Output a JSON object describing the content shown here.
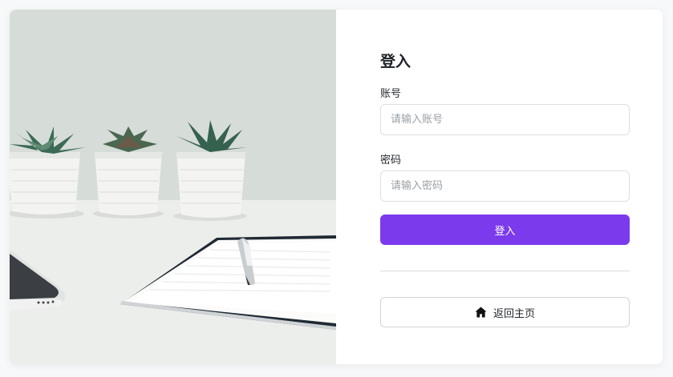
{
  "login": {
    "title": "登入",
    "account_label": "账号",
    "account_placeholder": "请输入账号",
    "account_value": "",
    "password_label": "密码",
    "password_placeholder": "请输入密码",
    "password_value": "",
    "submit_label": "登入",
    "home_label": "返回主页",
    "home_icon": "home-icon"
  },
  "hero": {
    "image": "desk-with-succulents-notebook-pen-phone"
  },
  "colors": {
    "accent": "#7c3aed",
    "background": "#f6f8fa",
    "card": "#ffffff",
    "border": "#dcdfe4"
  }
}
